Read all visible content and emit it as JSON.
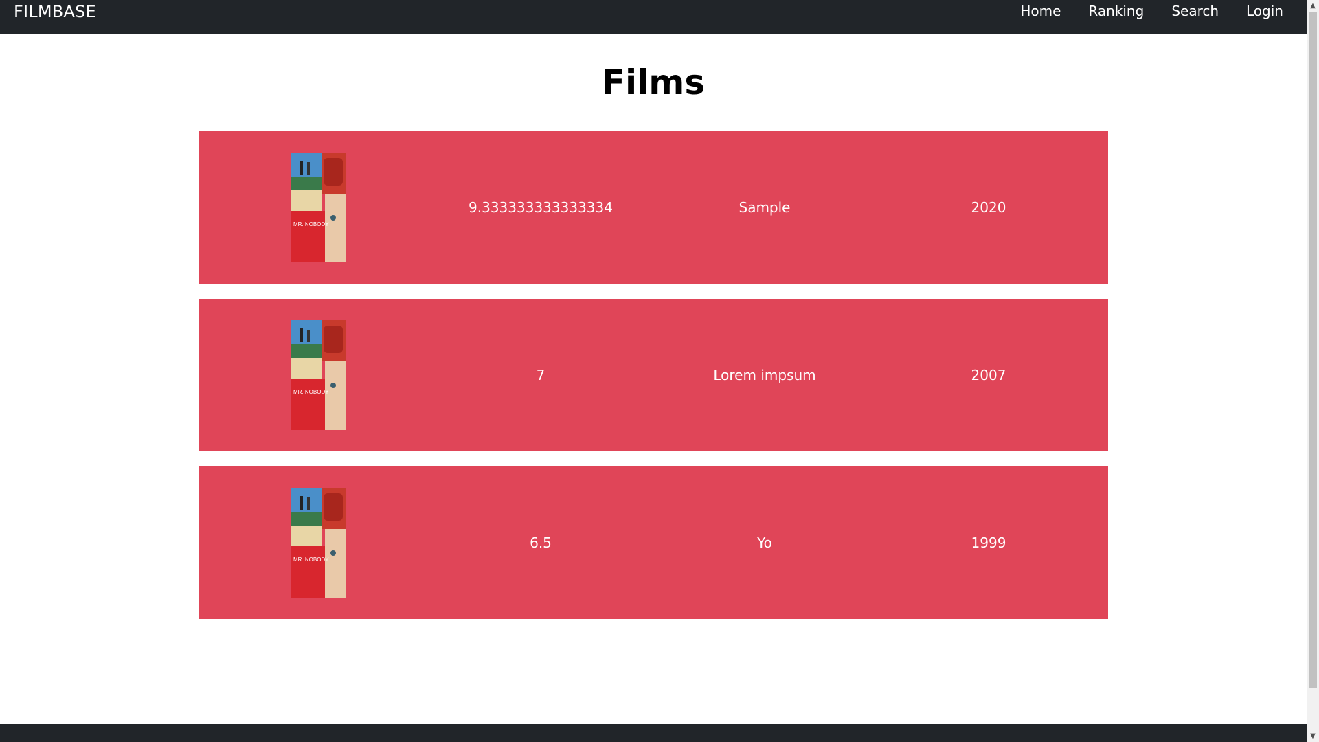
{
  "nav": {
    "brand": "FILMBASE",
    "links": [
      {
        "label": "Home"
      },
      {
        "label": "Ranking"
      },
      {
        "label": "Search"
      },
      {
        "label": "Login"
      }
    ]
  },
  "main": {
    "title": "Films",
    "films": [
      {
        "rating": "9.333333333333334",
        "title": "Sample",
        "year": "2020",
        "poster_text": "MR. NOBODY"
      },
      {
        "rating": "7",
        "title": "Lorem impsum",
        "year": "2007",
        "poster_text": "MR. NOBODY"
      },
      {
        "rating": "6.5",
        "title": "Yo",
        "year": "1999",
        "poster_text": "MR. NOBODY"
      }
    ]
  },
  "colors": {
    "navbar": "#212529",
    "card": "#e04558",
    "footer": "#212529"
  },
  "icons": {
    "scroll_up": "chevron-up-icon",
    "scroll_down": "chevron-down-icon"
  }
}
